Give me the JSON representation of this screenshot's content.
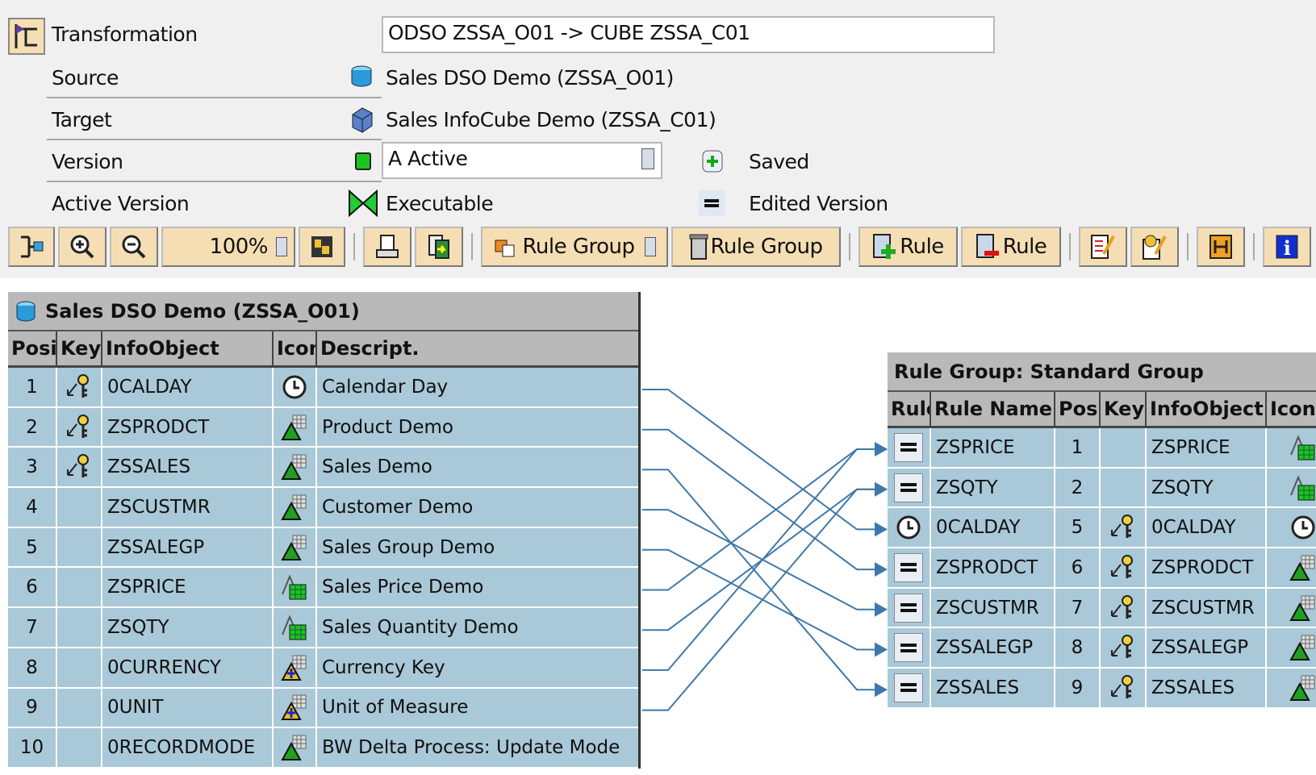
{
  "header": {
    "transformation_label": "Transformation",
    "transformation_value": "ODSO ZSSA_O01 -> CUBE ZSSA_C01",
    "source_label": "Source",
    "source_value": "Sales DSO Demo (ZSSA_O01)",
    "target_label": "Target",
    "target_value": "Sales InfoCube Demo (ZSSA_C01)",
    "version_label": "Version",
    "version_value": "A Active",
    "saved_label": "Saved",
    "active_version_label": "Active Version",
    "active_version_value": "Executable",
    "edited_label": "Edited Version"
  },
  "toolbar": {
    "zoom": "100%",
    "rule_group_new": "Rule Group",
    "rule_group_delete": "Rule Group",
    "rule_add": "Rule",
    "rule_delete": "Rule"
  },
  "source_table": {
    "title": "Sales DSO Demo (ZSSA_O01)",
    "columns": [
      "Posi",
      "Key",
      "InfoObject",
      "Icon",
      "Descript."
    ],
    "rows": [
      {
        "pos": "1",
        "key": true,
        "obj": "0CALDAY",
        "icon": "clock",
        "desc": "Calendar Day"
      },
      {
        "pos": "2",
        "key": true,
        "obj": "ZSPRODCT",
        "icon": "char",
        "desc": "Product Demo"
      },
      {
        "pos": "3",
        "key": true,
        "obj": "ZSSALES",
        "icon": "char",
        "desc": "Sales Demo"
      },
      {
        "pos": "4",
        "key": false,
        "obj": "ZSCUSTMR",
        "icon": "char",
        "desc": "Customer Demo"
      },
      {
        "pos": "5",
        "key": false,
        "obj": "ZSSALEGP",
        "icon": "char",
        "desc": "Sales Group Demo"
      },
      {
        "pos": "6",
        "key": false,
        "obj": "ZSPRICE",
        "icon": "keyfig",
        "desc": "Sales Price Demo"
      },
      {
        "pos": "7",
        "key": false,
        "obj": "ZSQTY",
        "icon": "keyfig",
        "desc": "Sales Quantity Demo"
      },
      {
        "pos": "8",
        "key": false,
        "obj": "0CURRENCY",
        "icon": "unit",
        "desc": "Currency Key"
      },
      {
        "pos": "9",
        "key": false,
        "obj": "0UNIT",
        "icon": "unit",
        "desc": "Unit of Measure"
      },
      {
        "pos": "10",
        "key": false,
        "obj": "0RECORDMODE",
        "icon": "char",
        "desc": "BW Delta Process: Update Mode"
      }
    ]
  },
  "target_table": {
    "title": "Rule Group: Standard Group",
    "columns": [
      "Rule",
      "Rule Name",
      "Pos",
      "Key",
      "InfoObject",
      "Icon"
    ],
    "rows": [
      {
        "rule": "equal",
        "name": "ZSPRICE",
        "pos": "1",
        "key": false,
        "obj": "ZSPRICE",
        "icon": "keyfig"
      },
      {
        "rule": "equal",
        "name": "ZSQTY",
        "pos": "2",
        "key": false,
        "obj": "ZSQTY",
        "icon": "keyfig"
      },
      {
        "rule": "clock",
        "name": "0CALDAY",
        "pos": "5",
        "key": true,
        "obj": "0CALDAY",
        "icon": "clock"
      },
      {
        "rule": "equal",
        "name": "ZSPRODCT",
        "pos": "6",
        "key": true,
        "obj": "ZSPRODCT",
        "icon": "char"
      },
      {
        "rule": "equal",
        "name": "ZSCUSTMR",
        "pos": "7",
        "key": true,
        "obj": "ZSCUSTMR",
        "icon": "char"
      },
      {
        "rule": "equal",
        "name": "ZSSALEGP",
        "pos": "8",
        "key": true,
        "obj": "ZSSALEGP",
        "icon": "char"
      },
      {
        "rule": "equal",
        "name": "ZSSALES",
        "pos": "9",
        "key": true,
        "obj": "ZSSALES",
        "icon": "char"
      }
    ]
  },
  "mappings": [
    [
      1,
      3
    ],
    [
      2,
      4
    ],
    [
      3,
      7
    ],
    [
      4,
      5
    ],
    [
      5,
      6
    ],
    [
      6,
      1
    ],
    [
      7,
      2
    ],
    [
      8,
      1
    ],
    [
      9,
      2
    ]
  ],
  "colors": {
    "row": "#a9c8d8",
    "line": "#3f78a8",
    "toolbar": "#f5deb3"
  }
}
